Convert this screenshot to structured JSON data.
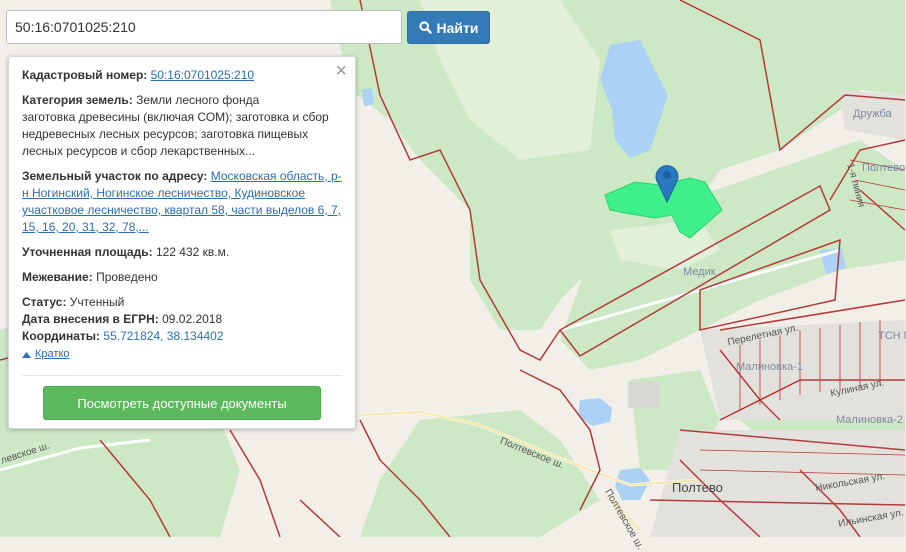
{
  "search": {
    "query": "50:16:0701025:210",
    "button_label": "Найти"
  },
  "panel": {
    "cadastral_label": "Кадастровый номер:",
    "cadastral_value": "50:16:0701025:210",
    "category_label": "Категория земель:",
    "category_lines": [
      "Земли лесного фонда",
      "заготовка древесины (включая СОМ); заготовка и сбор",
      "недревесных лесных ресурсов; заготовка пищевых",
      "лесных ресурсов и сбор лекарственных..."
    ],
    "address_label": "Земельный участок по адресу:",
    "address_lines": [
      "Московская область, р-",
      "н Ногинский, Ногинское лесничество, Кудиновское",
      "участковое лесничество, квартал 58, части выделов 6, 7,",
      "15, 16, 20, 31, 32, 78,..."
    ],
    "area_label": "Уточненная площадь:",
    "area_value": "122 432 кв.м.",
    "survey_label": "Межевание:",
    "survey_value": "Проведено",
    "status_label": "Статус:",
    "status_value": "Учтенный",
    "egrn_label": "Дата внесения в ЕГРН:",
    "egrn_value": "09.02.2018",
    "coords_label": "Координаты:",
    "coords_value": "55.721824, 38.134402",
    "toggle_label": "Кратко",
    "docs_button": "Посмотреть доступные документы",
    "close_glyph": "×"
  },
  "map_labels": {
    "druzhba": "Дружба",
    "poltevo_top": "Полтево",
    "first_line": "1-я линия",
    "medik": "Медик",
    "tsn": "ТСН П",
    "pereletnaya": "Перелетная ул.",
    "malinovka1": "Малиновка-1",
    "kulinaya": "Кулиная ул.",
    "malinovka2": "Малиновка-2",
    "poltevo": "Полтево",
    "poltevskoe_1": "Полтевское ш.",
    "poltevskoe_2": "Полтевское ш.",
    "nikolskaya": "Никольская ул.",
    "ilinskaya": "Ильинская ул.",
    "west_road": "левское ш."
  },
  "colors": {
    "parcel": "#3ef08a",
    "forest": "#c8e6c0",
    "water": "#abd2f5",
    "boundary": "#b53a3a",
    "marker": "#2a78c2",
    "search_button": "#337ab7",
    "docs_button": "#5cb85c"
  }
}
